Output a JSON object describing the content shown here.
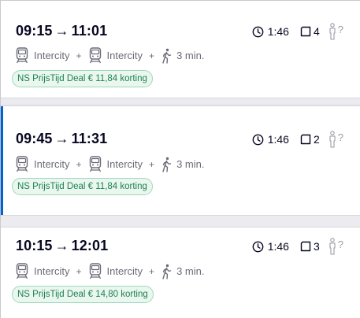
{
  "trips": [
    {
      "departure": "09:15",
      "arrival": "11:01",
      "arrow": "→",
      "duration": "1:46",
      "transfers": "4",
      "crowd": "?",
      "legs": [
        "Intercity",
        "Intercity"
      ],
      "plus": "+",
      "walk": "3 min.",
      "deal": "NS PrijsTijd Deal € 11,84 korting"
    },
    {
      "departure": "09:45",
      "arrival": "11:31",
      "arrow": "→",
      "duration": "1:46",
      "transfers": "2",
      "crowd": "?",
      "legs": [
        "Intercity",
        "Intercity"
      ],
      "plus": "+",
      "walk": "3 min.",
      "deal": "NS PrijsTijd Deal € 11,84 korting"
    },
    {
      "departure": "10:15",
      "arrival": "12:01",
      "arrow": "→",
      "duration": "1:46",
      "transfers": "3",
      "crowd": "?",
      "legs": [
        "Intercity",
        "Intercity"
      ],
      "plus": "+",
      "walk": "3 min.",
      "deal": "NS PrijsTijd Deal € 14,80 korting"
    }
  ],
  "selected_index": 1,
  "colors": {
    "time_text": "#070721",
    "leg_text": "#6b6b78",
    "deal_text": "#1f7f52",
    "deal_bg": "#e9f7ef",
    "deal_border": "#9fd7bd",
    "selected_accent": "#0063d3"
  },
  "icons": {
    "duration": "clock-icon",
    "transfers": "transfer-icon",
    "leg": "train-icon",
    "walk": "walking-icon",
    "crowd": "crowd-person-icon"
  }
}
